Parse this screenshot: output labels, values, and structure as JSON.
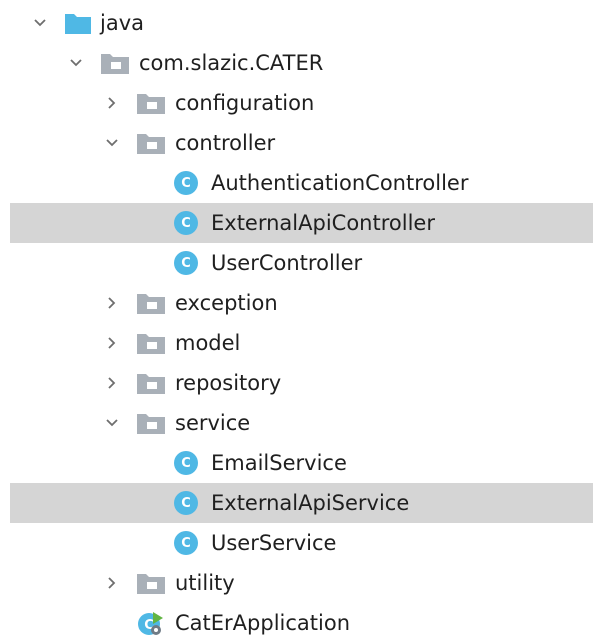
{
  "tree": {
    "nodes": [
      {
        "label": "java",
        "state": "expanded",
        "icon": "source-folder-icon"
      },
      {
        "label": "com.slazic.CATER",
        "state": "expanded",
        "icon": "package-icon"
      },
      {
        "label": "configuration",
        "state": "collapsed",
        "icon": "package-icon"
      },
      {
        "label": "controller",
        "state": "expanded",
        "icon": "package-icon"
      },
      {
        "label": "AuthenticationController",
        "icon": "class-icon"
      },
      {
        "label": "ExternalApiController",
        "icon": "class-icon",
        "selected": true
      },
      {
        "label": "UserController",
        "icon": "class-icon"
      },
      {
        "label": "exception",
        "state": "collapsed",
        "icon": "package-icon"
      },
      {
        "label": "model",
        "state": "collapsed",
        "icon": "package-icon"
      },
      {
        "label": "repository",
        "state": "collapsed",
        "icon": "package-icon"
      },
      {
        "label": "service",
        "state": "expanded",
        "icon": "package-icon"
      },
      {
        "label": "EmailService",
        "icon": "class-icon"
      },
      {
        "label": "ExternalApiService",
        "icon": "class-icon",
        "selected": true
      },
      {
        "label": "UserService",
        "icon": "class-icon"
      },
      {
        "label": "utility",
        "state": "collapsed",
        "icon": "package-icon"
      },
      {
        "label": "CatErApplication",
        "icon": "spring-boot-application-icon"
      }
    ],
    "class_badge_letter": "C",
    "colors": {
      "selection": "#d5d5d5",
      "source_folder": "#4fb8e5",
      "package_folder": "#a9b0b8",
      "class_badge": "#4fb8e5",
      "spring_leaf": "#62b543"
    }
  }
}
